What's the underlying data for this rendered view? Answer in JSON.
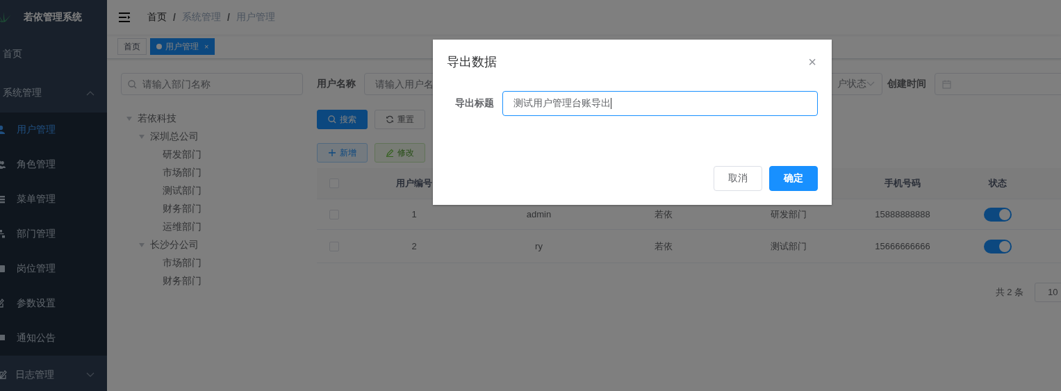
{
  "sidebar": {
    "title": "若依管理系统",
    "items": [
      {
        "label": "首页",
        "kind": "link"
      },
      {
        "label": "系统管理",
        "kind": "group",
        "expanded": true,
        "children": [
          {
            "label": "用户管理",
            "selected": true
          },
          {
            "label": "角色管理",
            "selected": false
          },
          {
            "label": "菜单管理",
            "selected": false
          },
          {
            "label": "部门管理",
            "selected": false
          },
          {
            "label": "岗位管理",
            "selected": false
          },
          {
            "label": "参数设置",
            "selected": false
          },
          {
            "label": "通知公告",
            "selected": false
          }
        ]
      },
      {
        "label": "日志管理",
        "kind": "group",
        "expanded": false
      }
    ]
  },
  "breadcrumb": {
    "separator": "/",
    "items": [
      "首页",
      "系统管理",
      "用户管理"
    ]
  },
  "tags": [
    {
      "label": "首页",
      "selected": false
    },
    {
      "label": "用户管理",
      "selected": true,
      "close": "×"
    }
  ],
  "dept_search": {
    "placeholder": "请输入部门名称"
  },
  "dept_tree": [
    {
      "label": "若依科技",
      "expanded": true,
      "children": [
        {
          "label": "深圳总公司",
          "expanded": true,
          "children": [
            {
              "label": "研发部门"
            },
            {
              "label": "市场部门"
            },
            {
              "label": "测试部门"
            },
            {
              "label": "财务部门"
            },
            {
              "label": "运维部门"
            }
          ]
        },
        {
          "label": "长沙分公司",
          "expanded": true,
          "children": [
            {
              "label": "市场部门"
            },
            {
              "label": "财务部门"
            }
          ]
        }
      ]
    }
  ],
  "query_form": [
    {
      "kind": "input",
      "label": "用户名称",
      "placeholder": "请输入用户名"
    },
    {
      "kind": "select",
      "placeholder": "户状态"
    },
    {
      "kind": "date",
      "label": "创建时间"
    }
  ],
  "search_buttons": [
    {
      "label": "搜索",
      "kind": "search"
    },
    {
      "label": "重置",
      "kind": "reset"
    }
  ],
  "toolbar": [
    {
      "label": "新增",
      "kind": "add"
    },
    {
      "label": "修改",
      "kind": "edit"
    }
  ],
  "table": {
    "all_checked": false,
    "columns": [
      "用户编号",
      "手机号码",
      "状态"
    ],
    "rows": [
      {
        "checked": false,
        "user_id": "1",
        "user_name": "admin",
        "nick_name": "若依",
        "dept": "研发部门",
        "phone": "15888888888",
        "status_on": true
      },
      {
        "checked": false,
        "user_id": "2",
        "user_name": "ry",
        "nick_name": "若依",
        "dept": "测试部门",
        "phone": "15666666666",
        "status_on": true
      }
    ]
  },
  "pagination": {
    "total": "共 2 条",
    "page_size": "10"
  },
  "dialog": {
    "title": "导出数据",
    "close": "×",
    "field_label": "导出标题",
    "field_value": "测试用户管理台账导出",
    "buttons": [
      {
        "label": "取消",
        "kind": "default"
      },
      {
        "label": "确定",
        "kind": "primary"
      }
    ]
  }
}
